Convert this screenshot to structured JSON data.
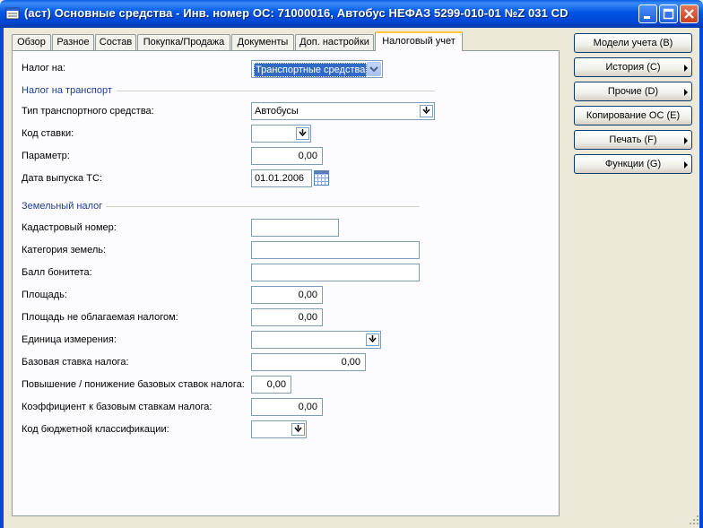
{
  "window": {
    "title": "(аст) Основные средства - Инв. номер ОС: 71000016, Автобус НЕФАЗ 5299-010-01 №Z 031 CD",
    "icons": {
      "app": "form-icon",
      "minimize": "minimize-icon",
      "maximize": "maximize-icon",
      "close": "close-icon"
    }
  },
  "tabs": [
    {
      "label": "Обзор"
    },
    {
      "label": "Разное"
    },
    {
      "label": "Состав"
    },
    {
      "label": "Покупка/Продажа"
    },
    {
      "label": "Документы"
    },
    {
      "label": "Доп. настройки"
    },
    {
      "label": "Налоговый учет",
      "active": true
    }
  ],
  "form": {
    "nalog_na": {
      "label": "Налог на:",
      "value": "Транспортные средства"
    },
    "transport_section": "Налог на транспорт",
    "vehicle_type": {
      "label": "Тип транспортного средства:",
      "value": "Автобусы"
    },
    "rate_code": {
      "label": "Код ставки:",
      "value": ""
    },
    "parameter": {
      "label": "Параметр:",
      "value": "0,00"
    },
    "release_date": {
      "label": "Дата выпуска ТС:",
      "value": "01.01.2006"
    },
    "land_section": "Земельный налог",
    "cadastral": {
      "label": "Кадастровый номер:",
      "value": ""
    },
    "land_category": {
      "label": "Категория земель:",
      "value": ""
    },
    "bonitet": {
      "label": "Балл бонитета:",
      "value": ""
    },
    "area": {
      "label": "Площадь:",
      "value": "0,00"
    },
    "untaxed_area": {
      "label": "Площадь не облагаемая налогом:",
      "value": "0,00"
    },
    "unit": {
      "label": "Единица измерения:",
      "value": ""
    },
    "base_rate": {
      "label": "Базовая ставка налога:",
      "value": "0,00"
    },
    "rate_change": {
      "label": "Повышение / понижение базовых ставок налога:",
      "value": "0,00"
    },
    "coefficient": {
      "label": "Коэффициент к базовым ставкам налога:",
      "value": "0,00"
    },
    "budget_code": {
      "label": "Код бюджетной классификации:",
      "value": ""
    }
  },
  "side_buttons": [
    {
      "label": "Модели учета (В)",
      "submenu": false
    },
    {
      "label": "История (С)",
      "submenu": true
    },
    {
      "label": "Прочие (D)",
      "submenu": true
    },
    {
      "label": "Копирование ОС (Е)",
      "submenu": false
    },
    {
      "label": "Печать (F)",
      "submenu": true
    },
    {
      "label": "Функции (G)",
      "submenu": true
    }
  ],
  "colors": {
    "titlebar": "#0055E5",
    "section": "#1F3C9B",
    "selection": "#316AC5",
    "tab_highlight": "#FFC83C"
  }
}
